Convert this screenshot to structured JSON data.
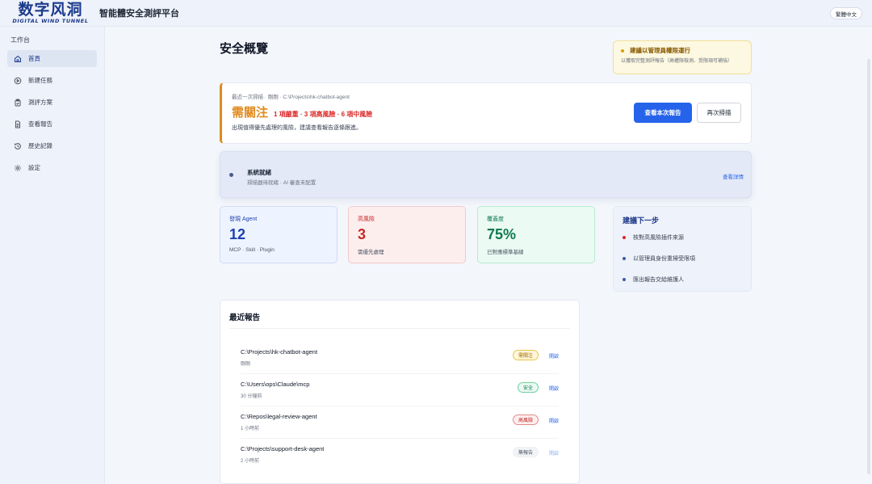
{
  "brand": {
    "logo_main": "数字风洞",
    "logo_sub": "DIGITAL WIND TUNNEL",
    "app_title": "智能體安全測評平台",
    "language_button": "繁體中文"
  },
  "sidebar": {
    "section_label": "工作台",
    "items": [
      {
        "label": "首頁",
        "icon": "home-icon",
        "active": true
      },
      {
        "label": "新建任務",
        "icon": "play-circle-icon",
        "active": false
      },
      {
        "label": "測評方案",
        "icon": "clipboard-icon",
        "active": false
      },
      {
        "label": "查看報告",
        "icon": "document-icon",
        "active": false
      },
      {
        "label": "歷史記錄",
        "icon": "history-icon",
        "active": false
      },
      {
        "label": "設定",
        "icon": "gear-icon",
        "active": false
      }
    ]
  },
  "main": {
    "page_title": "安全概覽",
    "admin_tip": {
      "title": "建議以管理員權限運行",
      "text": "以獲取完整測評報告（高權限檢測、受限項可補強）"
    },
    "last_scan": {
      "meta": "最近一次掃描 · 剛剛 · C:\\Projects\\hk-chatbot-agent",
      "status": "需關注",
      "counts": "1 項嚴重 · 3 項高風險 · 6 項中風險",
      "description": "出現值得優先處理的風險，建議查看報告逐條跟進。",
      "primary_button": "查看本次報告",
      "secondary_button": "再次掃描"
    },
    "engine": {
      "name": "系統就緒",
      "detail": "掃描器待就緒 · AI 審查未配置",
      "link": "查看詳情"
    },
    "stats": [
      {
        "label": "發現 Agent",
        "value": "12",
        "sub": "MCP · Skill · Plugin",
        "tone": "blue"
      },
      {
        "label": "高風險",
        "value": "3",
        "sub": "需優先處理",
        "tone": "red"
      },
      {
        "label": "覆蓋度",
        "value": "75%",
        "sub": "已對應標準基線",
        "tone": "green"
      }
    ],
    "next_steps": {
      "title": "建議下一步",
      "items": [
        {
          "text": "核對高風險插件來源",
          "color": "#dc2626"
        },
        {
          "text": "以管理員身份重掃受限項",
          "color": "#3b5ba9"
        },
        {
          "text": "匯出報告交給維護人",
          "color": "#3b5ba9"
        }
      ]
    },
    "recent_reports": {
      "title": "最近報告",
      "rows": [
        {
          "path": "C:\\Projects\\hk-chatbot-agent",
          "time": "剛剛",
          "badge": "需關注",
          "tone": "warn",
          "action": "開啟"
        },
        {
          "path": "C:\\Users\\ops\\Claude\\mcp",
          "time": "30 分鐘前",
          "badge": "安全",
          "tone": "safe",
          "action": "開啟"
        },
        {
          "path": "C:\\Repos\\legal-review-agent",
          "time": "1 小時前",
          "badge": "高風險",
          "tone": "high",
          "action": "開啟"
        },
        {
          "path": "C:\\Projects\\support-desk-agent",
          "time": "2 小時前",
          "badge": "無報告",
          "tone": "none",
          "action": "開啟"
        }
      ]
    }
  }
}
